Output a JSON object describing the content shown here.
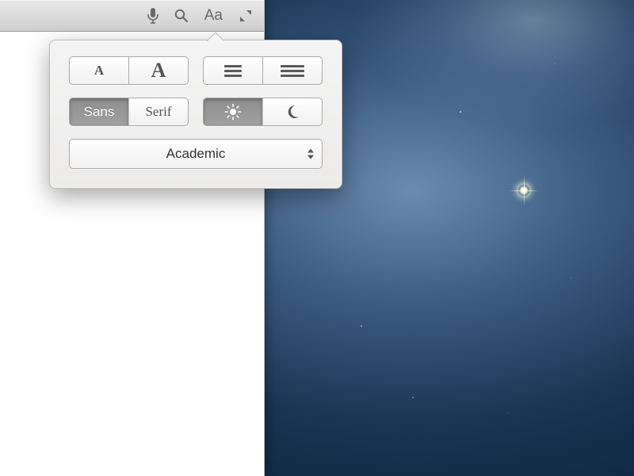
{
  "toolbar": {
    "aa_label": "Aa"
  },
  "popover": {
    "font_size": {
      "small_glyph": "A",
      "large_glyph": "A"
    },
    "font_family": {
      "sans_label": "Sans",
      "serif_label": "Serif",
      "selected": "sans"
    },
    "theme": {
      "selected": "light"
    },
    "preset": {
      "selected_label": "Academic"
    }
  }
}
